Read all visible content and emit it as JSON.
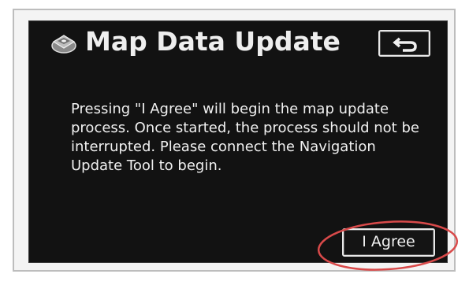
{
  "screen": {
    "title": "Map Data Update",
    "title_icon": "map-disc-icon",
    "back_icon": "return-arrow-icon",
    "message": "Pressing \"I Agree\" will begin the map update\nprocess.  Once started, the process should not be\ninterrupted.  Please connect the Navigation\nUpdate Tool to begin.",
    "agree_label": "I Agree"
  },
  "colors": {
    "screen_background": "#121212",
    "text": "#f0f0f0",
    "highlight": "#d94a4a"
  }
}
